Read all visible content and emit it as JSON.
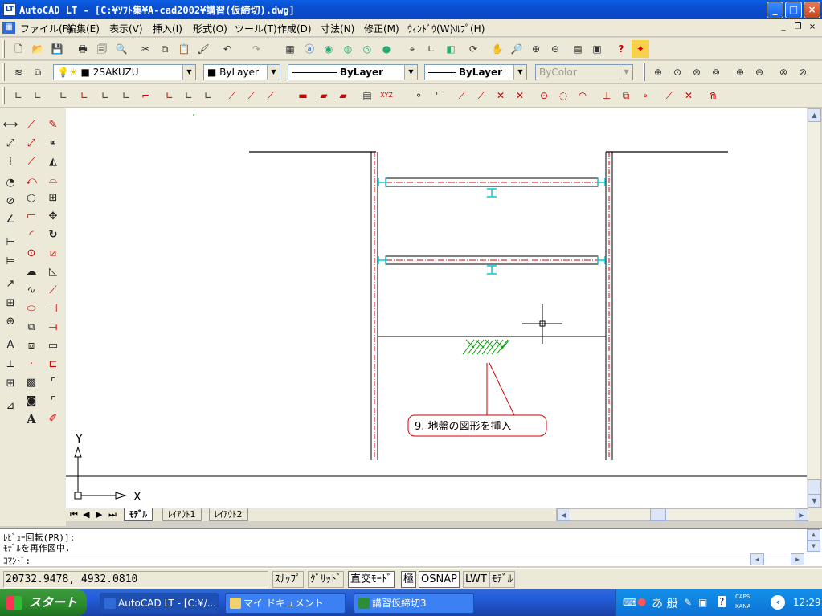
{
  "window": {
    "title": "AutoCAD LT - [C:¥ｿﾌﾄ集¥A-cad2002¥講習(仮締切).dwg]",
    "icon_label": "LT"
  },
  "window_buttons": {
    "minimize": "_",
    "maximize": "□",
    "close": "×"
  },
  "menu": [
    "ファイル(F)",
    "編集(E)",
    "表示(V)",
    "挿入(I)",
    "形式(O)",
    "ツール(T)",
    "作成(D)",
    "寸法(N)",
    "修正(M)",
    "ｳｨﾝﾄﾞｳ(W)",
    "ﾍﾙﾌﾟ(H)"
  ],
  "mdi_buttons": {
    "minimize": "_",
    "restore": "❐",
    "close": "×"
  },
  "layer_toolbar": {
    "layer_name": "2SAKUZU",
    "color": "ByLayer",
    "linetype": "ByLayer",
    "lineweight": "ByLayer",
    "plotstyle": "ByColor"
  },
  "drawing": {
    "annotation": "9. 地盤の図形を挿入",
    "ucs_x": "X",
    "ucs_y": "Y"
  },
  "tabs": {
    "model": "ﾓﾃﾞﾙ",
    "layout1": "ﾚｲｱｳﾄ1",
    "layout2": "ﾚｲｱｳﾄ2"
  },
  "command": {
    "line1": "ﾚﾋﾞｭｰ回転(PR)]:",
    "line2": "ﾓﾃﾞﾙを再作図中.",
    "prompt": "ｺﾏﾝﾄﾞ:"
  },
  "status": {
    "coords": "20732.9478, 4932.0810",
    "snap": "ｽﾅｯﾌﾟ",
    "grid": "ｸﾞﾘｯﾄﾞ",
    "ortho": "直交ﾓｰﾄﾞ",
    "polar": "極",
    "osnap": "OSNAP",
    "lwt": "LWT",
    "model": "ﾓﾃﾞﾙ"
  },
  "taskbar": {
    "start": "スタート",
    "tasks": [
      "AutoCAD LT - [C:¥/...",
      "マイ ドキュメント",
      "講習仮締切3"
    ],
    "ime": "あ 般",
    "caps": "CAPS",
    "kana": "KANA",
    "clock": "12:29"
  },
  "colors": {
    "title_bar": "#0a46c4",
    "menu_bg": "#ece9d8",
    "canvas": "#ffffff",
    "cyan": "#00c8d8",
    "red": "#cc0000",
    "green": "#00a000"
  }
}
